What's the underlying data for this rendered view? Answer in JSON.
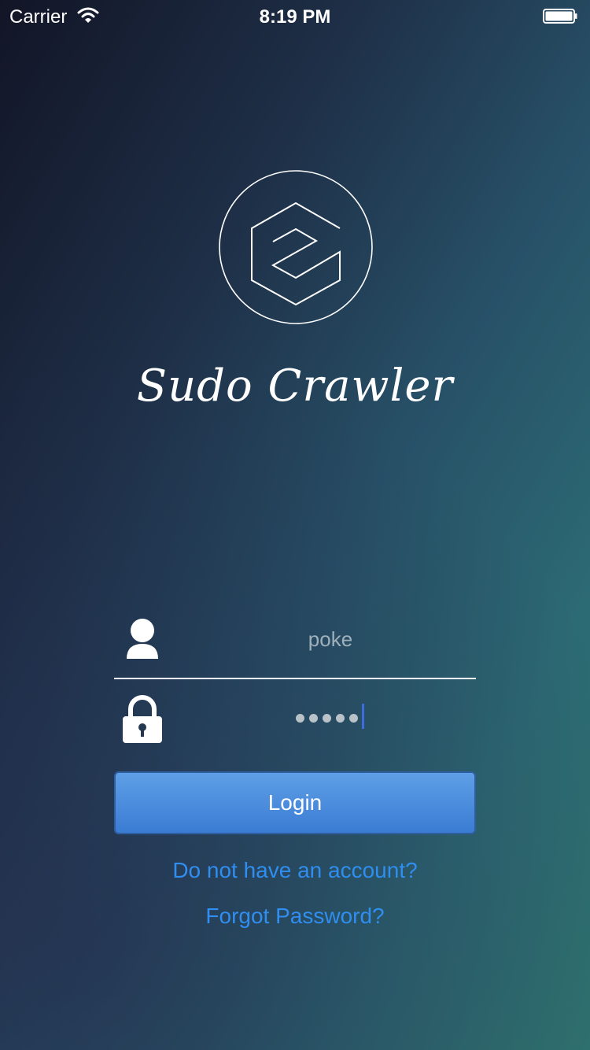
{
  "status_bar": {
    "carrier": "Carrier",
    "time": "8:19 PM",
    "wifi_icon": "wifi-icon",
    "battery_icon": "battery-icon"
  },
  "app": {
    "name": "Sudo Crawler",
    "logo_icon": "hexagon-s-logo"
  },
  "form": {
    "username_value": "poke",
    "password_mask": "•••••",
    "user_icon": "user-icon",
    "lock_icon": "lock-icon",
    "login_label": "Login"
  },
  "links": {
    "signup": "Do not have an account?",
    "forgot": "Forgot Password?"
  },
  "colors": {
    "accent_link": "#2f8ef0",
    "button_top": "#5e9fe6",
    "button_bottom": "#3b7cd4",
    "caret": "#3d6ddc"
  }
}
